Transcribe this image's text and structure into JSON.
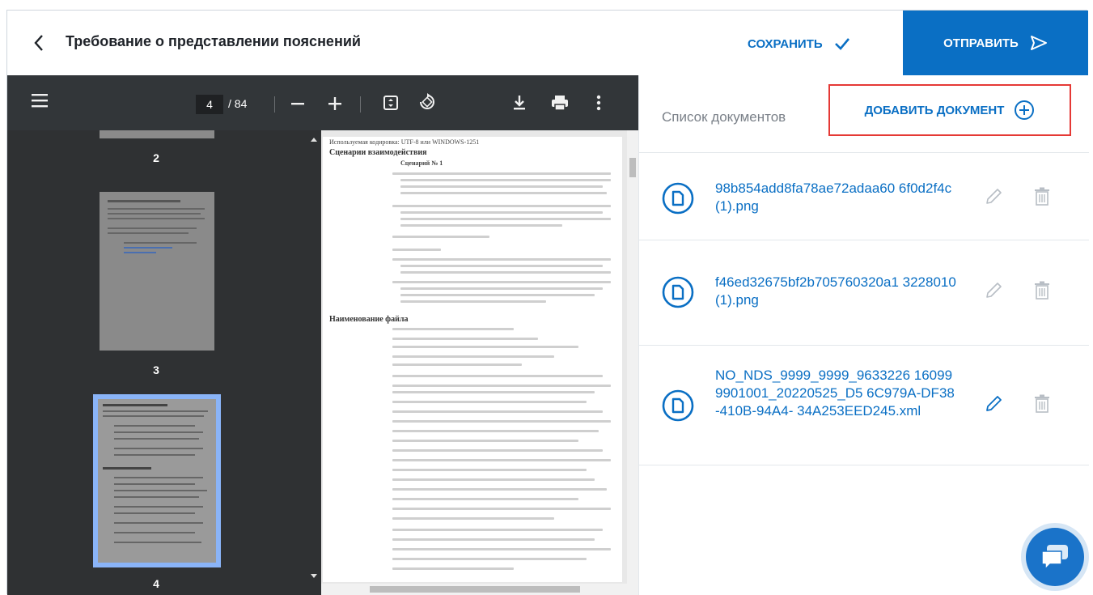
{
  "header": {
    "title": "Требование о представлении пояснений",
    "save_label": "СОХРАНИТЬ",
    "send_label": "ОТПРАВИТЬ"
  },
  "viewer": {
    "current_page": "4",
    "total_pages": "/ 84",
    "thumbnails": [
      {
        "label": "2"
      },
      {
        "label": "3"
      },
      {
        "label": "4"
      }
    ],
    "doc": {
      "encoding_line": "Используемая кодировка: UTF-8 или WINDOWS-1251",
      "heading1": "Сценарии взаимодействия",
      "scenario": "Сценарий № 1",
      "heading2": "Наименование файла"
    }
  },
  "panel": {
    "list_label": "Список документов",
    "add_label": "ДОБАВИТЬ ДОКУМЕНТ",
    "documents": [
      {
        "name": "98b854add8fa78ae72adaa60 6f0d2f4c (1).png"
      },
      {
        "name": "f46ed32675bf2b705760320a1 3228010 (1).png"
      },
      {
        "name": "NO_NDS_9999_9999_9633226 160999901001_20220525_D5 6C979A-DF38-410B-94A4- 34A253EED245.xml"
      }
    ]
  },
  "colors": {
    "brand_blue": "#0a6fc4",
    "viewer_dark": "#323639",
    "highlight_red": "#e53935"
  },
  "icons": [
    "chevron-left-icon",
    "check-icon",
    "send-icon",
    "menu-icon",
    "minus-icon",
    "plus-icon",
    "fit-page-icon",
    "rotate-icon",
    "download-icon",
    "print-icon",
    "more-vert-icon",
    "add-circle-icon",
    "document-icon",
    "pencil-icon",
    "trash-icon",
    "chat-icon"
  ]
}
